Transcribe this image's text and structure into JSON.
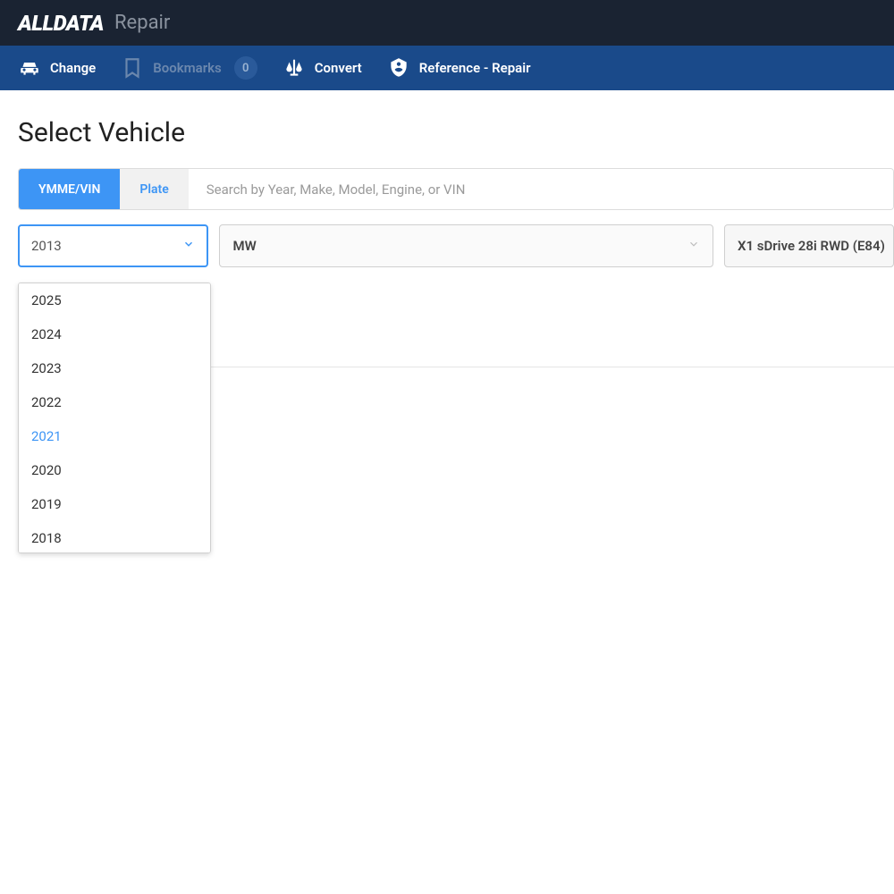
{
  "header": {
    "logo": "ALLDATA",
    "section": "Repair"
  },
  "nav": {
    "change": "Change",
    "bookmarks": "Bookmarks",
    "bookmarks_count": "0",
    "convert": "Convert",
    "reference": "Reference - Repair"
  },
  "page": {
    "title": "Select Vehicle"
  },
  "tabs": {
    "ymme": "YMME/VIN",
    "plate": "Plate"
  },
  "search": {
    "placeholder": "Search by Year, Make, Model, Engine, or VIN"
  },
  "dropdowns": {
    "year": "2013",
    "make": "MW",
    "model": "X1 sDrive 28i RWD (E84)"
  },
  "year_options": [
    "2025",
    "2024",
    "2023",
    "2022",
    "2021",
    "2020",
    "2019",
    "2018"
  ],
  "year_hover_index": 4,
  "breadcrumb": "ve 28i RWD (E84)"
}
